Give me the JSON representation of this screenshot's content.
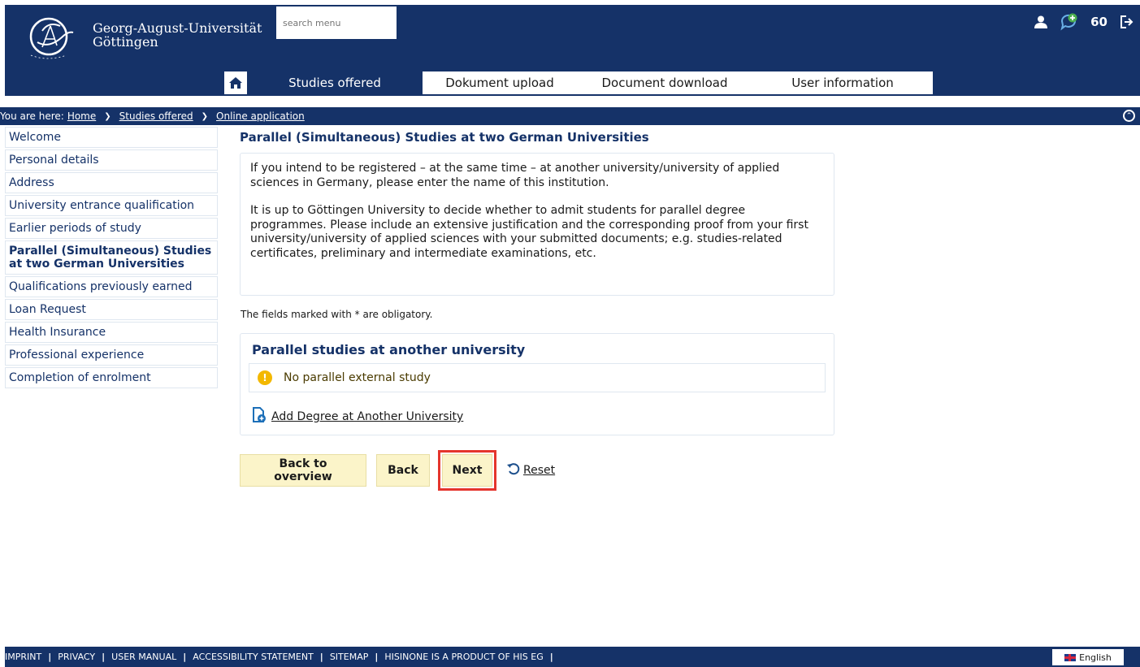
{
  "header": {
    "brand_line1": "Georg-August-Universität",
    "brand_line2": "Göttingen",
    "search_placeholder": "search menu",
    "counter": "60"
  },
  "nav": {
    "tabs": [
      {
        "label": "Studies offered",
        "active": true
      },
      {
        "label": "Dokument upload"
      },
      {
        "label": "Document download"
      },
      {
        "label": "User information"
      }
    ]
  },
  "breadcrumb": {
    "prefix": "You are here:",
    "items": [
      "Home",
      "Studies offered",
      "Online application"
    ]
  },
  "sidebar": {
    "items": [
      {
        "label": "Welcome"
      },
      {
        "label": "Personal details"
      },
      {
        "label": "Address"
      },
      {
        "label": "University entrance qualification"
      },
      {
        "label": "Earlier periods of study"
      },
      {
        "label": "Parallel (Simultaneous) Studies at two German Universities",
        "active": true
      },
      {
        "label": "Qualifications previously earned"
      },
      {
        "label": "Loan Request"
      },
      {
        "label": "Health Insurance"
      },
      {
        "label": "Professional experience"
      },
      {
        "label": "Completion of enrolment"
      }
    ]
  },
  "main": {
    "title": "Parallel (Simultaneous) Studies at two German Universities",
    "info_p1": "If you intend to be registered – at the same time – at another university/university of applied sciences in Germany, please enter the name of this institution.",
    "info_p2": "It is up to Göttingen University to decide whether to admit students for parallel degree programmes. Please include an extensive justification and the corresponding proof from your first university/university of applied sciences with your submitted documents; e.g. studies-related certificates, preliminary and intermediate examinations, etc.",
    "obligatory_note": "The fields marked with * are obligatory.",
    "panel_title": "Parallel studies at another university",
    "notice": "No parallel external study",
    "add_link": "Add Degree at Another University",
    "buttons": {
      "overview": "Back to overview",
      "back": "Back",
      "next": "Next",
      "reset": "Reset"
    }
  },
  "footer": {
    "links": [
      "IMPRINT",
      "PRIVACY",
      "USER MANUAL",
      "ACCESSIBILITY STATEMENT",
      "SITEMAP",
      "HISINONE IS A PRODUCT OF HIS EG"
    ],
    "language": "English"
  },
  "colors": {
    "primary": "#153268",
    "button_bg": "#fbf4c9",
    "highlight": "#e5352d",
    "info": "#f3b800"
  }
}
